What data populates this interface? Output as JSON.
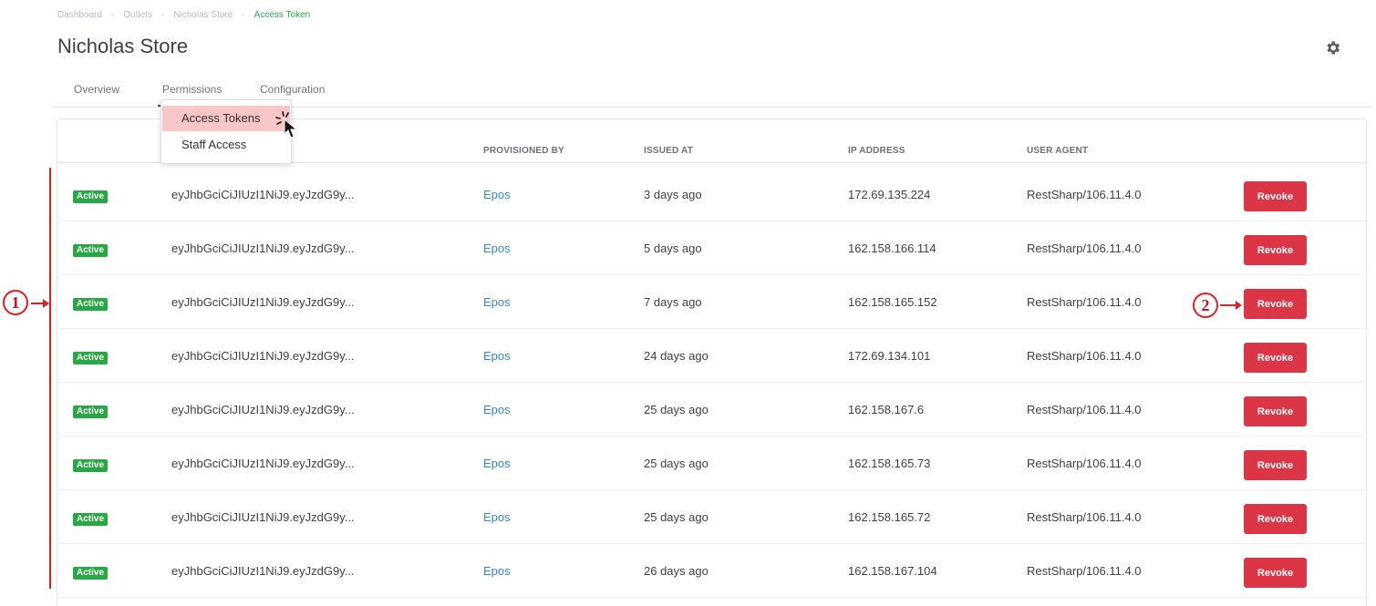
{
  "breadcrumb": [
    "Dashboard",
    "Outlets",
    "Nicholas Store",
    "Access Token"
  ],
  "page_title": "Nicholas Store",
  "tabs": [
    "Overview",
    "Permissions",
    "Configuration"
  ],
  "dropdown": [
    "Access Tokens",
    "Staff Access"
  ],
  "table": {
    "headers": [
      "PROVISIONED BY",
      "ISSUED AT",
      "IP ADDRESS",
      "USER AGENT"
    ],
    "rows": [
      {
        "status": "Active",
        "token": "eyJhbGciCiJIUzI1NiJ9.eyJzdG9y...",
        "provisioned_by": "Epos",
        "issued_at": "3 days ago",
        "ip": "172.69.135.224",
        "agent": "RestSharp/106.11.4.0",
        "action": "Revoke"
      },
      {
        "status": "Active",
        "token": "eyJhbGciCiJIUzI1NiJ9.eyJzdG9y...",
        "provisioned_by": "Epos",
        "issued_at": "5 days ago",
        "ip": "162.158.166.114",
        "agent": "RestSharp/106.11.4.0",
        "action": "Revoke"
      },
      {
        "status": "Active",
        "token": "eyJhbGciCiJIUzI1NiJ9.eyJzdG9y...",
        "provisioned_by": "Epos",
        "issued_at": "7 days ago",
        "ip": "162.158.165.152",
        "agent": "RestSharp/106.11.4.0",
        "action": "Revoke"
      },
      {
        "status": "Active",
        "token": "eyJhbGciCiJIUzI1NiJ9.eyJzdG9y...",
        "provisioned_by": "Epos",
        "issued_at": "24 days ago",
        "ip": "172.69.134.101",
        "agent": "RestSharp/106.11.4.0",
        "action": "Revoke"
      },
      {
        "status": "Active",
        "token": "eyJhbGciCiJIUzI1NiJ9.eyJzdG9y...",
        "provisioned_by": "Epos",
        "issued_at": "25 days ago",
        "ip": "162.158.167.6",
        "agent": "RestSharp/106.11.4.0",
        "action": "Revoke"
      },
      {
        "status": "Active",
        "token": "eyJhbGciCiJIUzI1NiJ9.eyJzdG9y...",
        "provisioned_by": "Epos",
        "issued_at": "25 days ago",
        "ip": "162.158.165.73",
        "agent": "RestSharp/106.11.4.0",
        "action": "Revoke"
      },
      {
        "status": "Active",
        "token": "eyJhbGciCiJIUzI1NiJ9.eyJzdG9y...",
        "provisioned_by": "Epos",
        "issued_at": "25 days ago",
        "ip": "162.158.165.72",
        "agent": "RestSharp/106.11.4.0",
        "action": "Revoke"
      },
      {
        "status": "Active",
        "token": "eyJhbGciCiJIUzI1NiJ9.eyJzdG9y...",
        "provisioned_by": "Epos",
        "issued_at": "26 days ago",
        "ip": "162.158.167.104",
        "agent": "RestSharp/106.11.4.0",
        "action": "Revoke"
      }
    ]
  },
  "annotations": [
    "1",
    "2"
  ],
  "icons": {
    "settings": "gear-icon",
    "pointer": "hand-cursor-icon"
  },
  "colors": {
    "active": "#28a745",
    "revoke": "#dc3545",
    "link": "#2f86d6",
    "breadcrumb_current": "#2aa84a",
    "highlight": "#f7c6c6",
    "annotation": "#e02020"
  }
}
